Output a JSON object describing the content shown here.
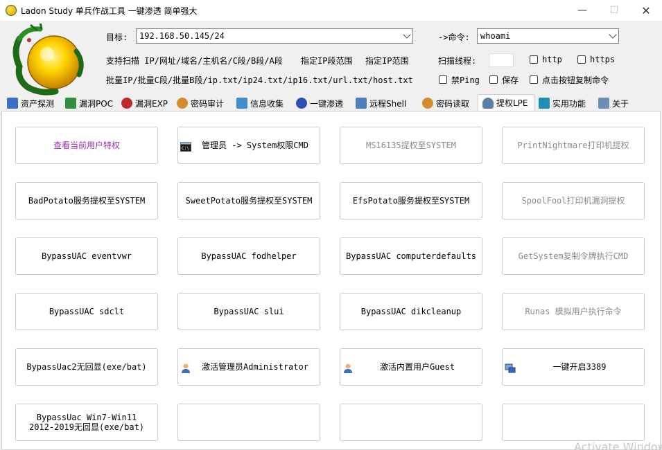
{
  "window": {
    "title": "Ladon Study 单兵作战工具 一键渗透 简单强大",
    "minimize": "—",
    "maximize": "☐",
    "close": "✕"
  },
  "header": {
    "target_label": "目标:",
    "target_value": "192.168.50.145/24",
    "command_label": "->命令:",
    "command_value": "whoami",
    "scan_support": "支持扫描 IP/网址/域名/主机名/C段/B段/A段",
    "ip_range": "指定IP段范围",
    "ip_scope": "指定IP范围",
    "batch": "批量IP/批量C段/批量B段/ip.txt/ip24.txt/ip16.txt/url.txt/host.txt",
    "threads_label": "扫描线程:",
    "http": "http",
    "https": "https",
    "ping": "禁Ping",
    "save": "保存",
    "copy_cmd": "点击按钮复制命令"
  },
  "tabs": [
    {
      "label": "资产探测",
      "icon": "monitor-icon",
      "color": "#3a6fc4"
    },
    {
      "label": "漏洞POC",
      "icon": "terminal-icon",
      "color": "#2f8f3a"
    },
    {
      "label": "漏洞EXP",
      "icon": "stop-icon",
      "color": "#c0282d"
    },
    {
      "label": "密码审计",
      "icon": "users-icon",
      "color": "#d88a2c"
    },
    {
      "label": "信息收集",
      "icon": "network-icon",
      "color": "#3c8fd0"
    },
    {
      "label": "一键渗透",
      "icon": "s-icon",
      "color": "#2c4fb3"
    },
    {
      "label": "远程Shell",
      "icon": "remote-icon",
      "color": "#4b7fc0"
    },
    {
      "label": "密码读取",
      "icon": "users-icon",
      "color": "#d88a2c"
    },
    {
      "label": "提权LPE",
      "icon": "person-icon",
      "color": "#5a7ca8"
    },
    {
      "label": "实用功能",
      "icon": "arrows-icon",
      "color": "#1c8fb8"
    },
    {
      "label": "关于",
      "icon": "speaker-icon",
      "color": "#6b8db8"
    }
  ],
  "buttons": [
    [
      "查看当前用户特权",
      "管理员 -> System权限CMD",
      "MS16135提权至SYSTEM",
      "PrintNightmare打印机提权"
    ],
    [
      "BadPotato服务提权至SYSTEM",
      "SweetPotato服务提权至SYSTEM",
      "EfsPotato服务提权至SYSTEM",
      "SpoolFool打印机漏洞提权"
    ],
    [
      "BypassUAC eventvwr",
      "BypassUAC fodhelper",
      "BypassUAC computerdefaults",
      "GetSystem复制令牌执行CMD"
    ],
    [
      "BypassUAC sdclt",
      "BypassUAC slui",
      "BypassUAC dikcleanup",
      "Runas 模拟用户执行命令"
    ],
    [
      "BypassUac2无回显(exe/bat)",
      "激活管理员Administrator",
      "激活内置用户Guest",
      "一键开启3389"
    ],
    [
      "BypassUac Win7-Win11\n2012-2019无回显(exe/bat)",
      "",
      "",
      ""
    ]
  ],
  "watermark": "Activate Windows"
}
